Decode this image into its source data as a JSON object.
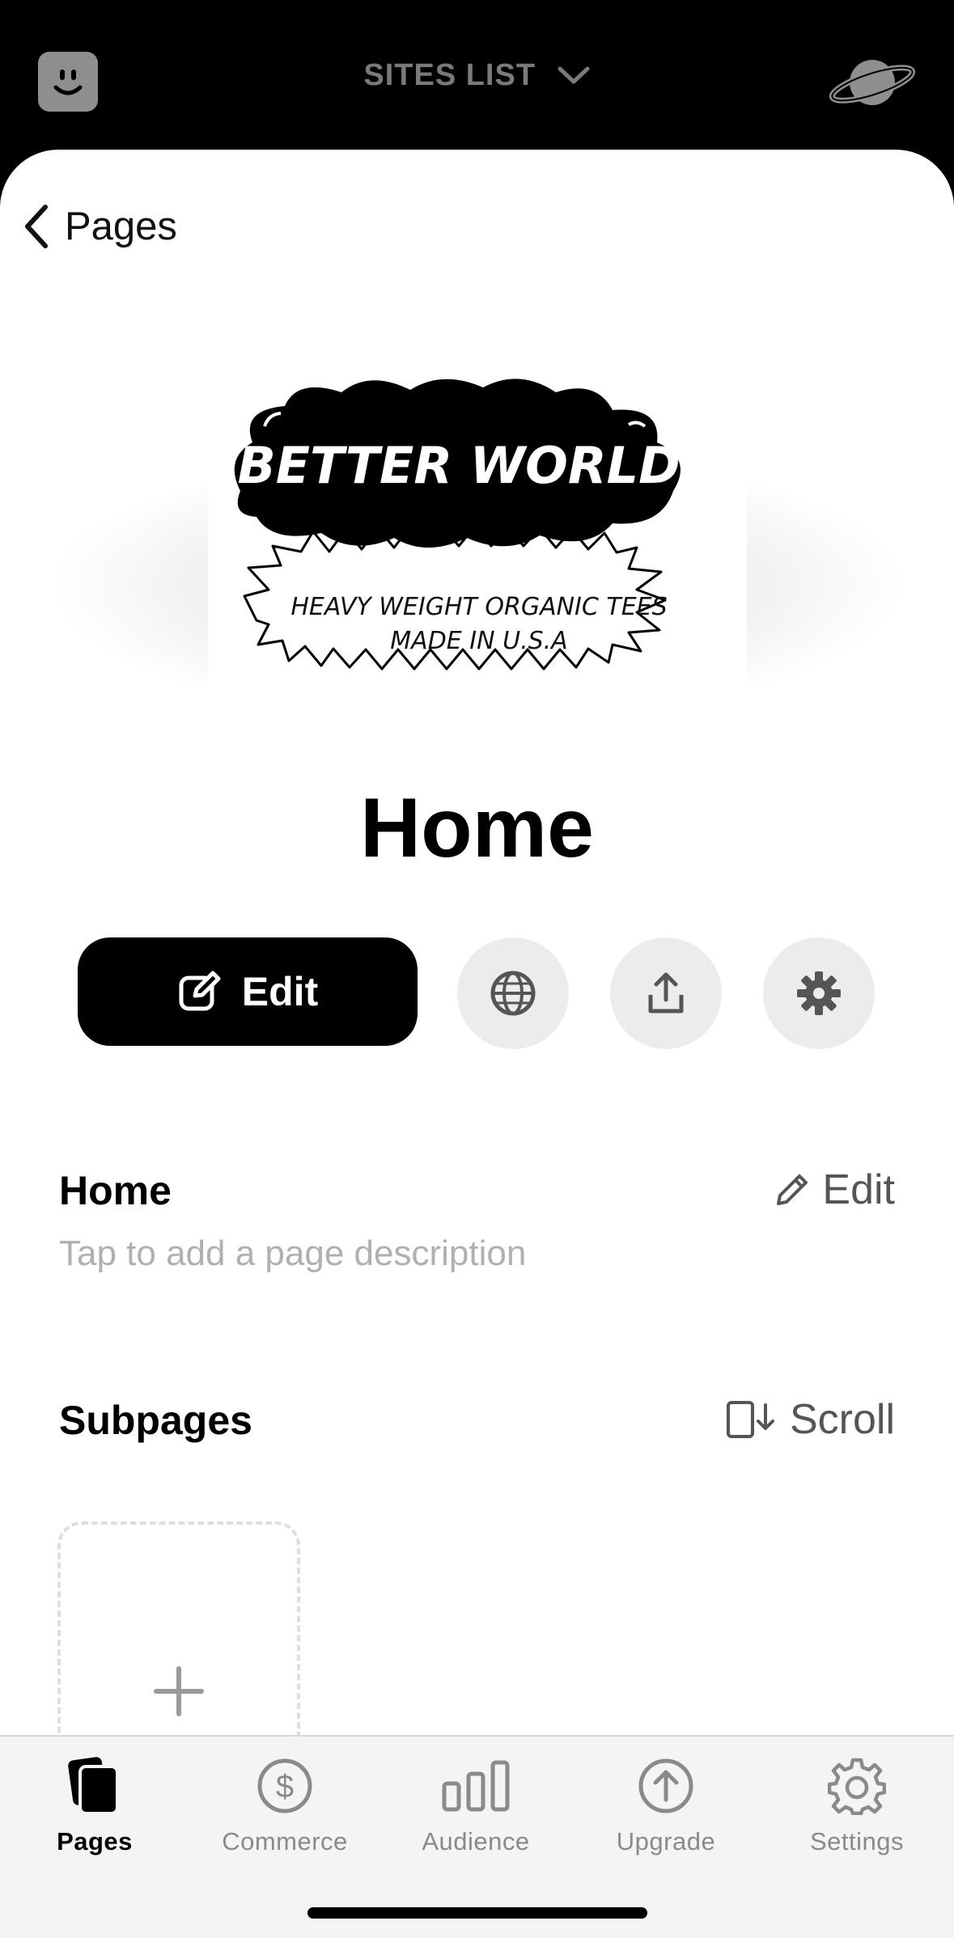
{
  "topbar": {
    "sites_label": "SITES LIST"
  },
  "nav": {
    "back_label": "Pages"
  },
  "preview": {
    "brand_name": "BETTER WORLD",
    "tagline_line1": "HEAVY WEIGHT ORGANIC TEES",
    "tagline_line2": "MADE IN U.S.A"
  },
  "page": {
    "title": "Home"
  },
  "actions": {
    "edit_label": "Edit"
  },
  "details": {
    "title": "Home",
    "edit_label": "Edit",
    "description_placeholder": "Tap to add a page description"
  },
  "subpages": {
    "title": "Subpages",
    "scroll_label": "Scroll"
  },
  "tabs": [
    {
      "label": "Pages",
      "icon": "pages-icon",
      "active": true
    },
    {
      "label": "Commerce",
      "icon": "dollar-icon"
    },
    {
      "label": "Audience",
      "icon": "bar-chart-icon"
    },
    {
      "label": "Upgrade",
      "icon": "upgrade-icon"
    },
    {
      "label": "Settings",
      "icon": "gear-icon"
    }
  ],
  "colors": {
    "accent": "#000000",
    "background": "#ffffff",
    "muted": "#8a8a8a"
  }
}
